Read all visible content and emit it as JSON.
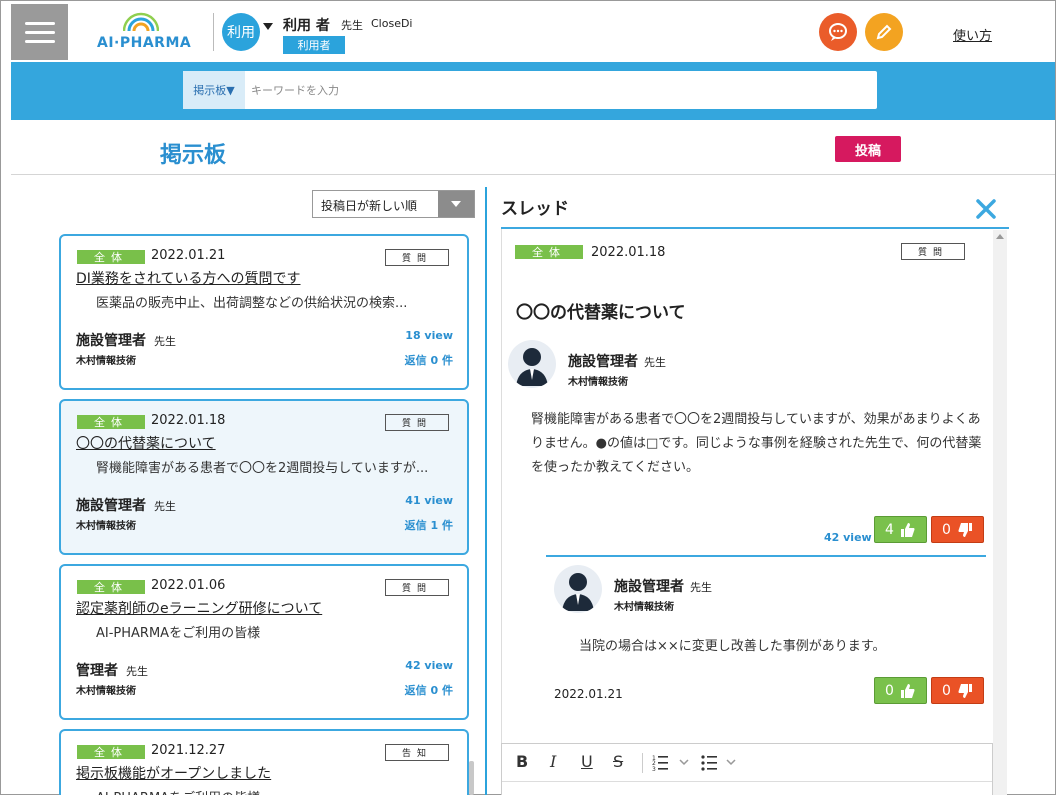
{
  "header": {
    "logo_text": "AI·PHARMA",
    "role_short": "利用",
    "user_name": "利用 者",
    "user_honorific": "先生",
    "user_org": "CloseDi",
    "user_role_badge": "利用者",
    "help_link": "使い方"
  },
  "search": {
    "category": "掲示板▼",
    "placeholder": "キーワードを入力"
  },
  "page": {
    "title": "掲示板",
    "post_button": "投稿"
  },
  "sort": {
    "selected": "投稿日が新しい順"
  },
  "posts": [
    {
      "category": "全体",
      "date": "2022.01.21",
      "type": "質問",
      "title": "DI業務をされている方への質問です",
      "excerpt": "医薬品の販売中止、出荷調整などの供給状況の検索...",
      "author": "施設管理者",
      "honorific": "先生",
      "org": "木村情報技術",
      "views": "18 view",
      "replies": "返信 0 件"
    },
    {
      "category": "全体",
      "date": "2022.01.18",
      "type": "質問",
      "title": "〇〇の代替薬について",
      "excerpt": "腎機能障害がある患者で〇〇を2週間投与していますが...",
      "author": "施設管理者",
      "honorific": "先生",
      "org": "木村情報技術",
      "views": "41 view",
      "replies": "返信 1 件"
    },
    {
      "category": "全体",
      "date": "2022.01.06",
      "type": "質問",
      "title": "認定薬剤師のeラーニング研修について",
      "excerpt": "AI-PHARMAをご利用の皆様",
      "author": "管理者",
      "honorific": "先生",
      "org": "木村情報技術",
      "views": "42 view",
      "replies": "返信 0 件"
    },
    {
      "category": "全体",
      "date": "2021.12.27",
      "type": "告知",
      "title": "掲示板機能がオープンしました",
      "excerpt": "AI-PHARMAをご利用の皆様",
      "author": "",
      "honorific": "",
      "org": "",
      "views": "",
      "replies": ""
    }
  ],
  "thread": {
    "heading": "スレッド",
    "category": "全体",
    "date": "2022.01.18",
    "type": "質問",
    "subject": "〇〇の代替薬について",
    "author": "施設管理者",
    "honorific": "先生",
    "org": "木村情報技術",
    "body": "腎機能障害がある患者で〇〇を2週間投与していますが、効果があまりよくありません。●の値は□です。同じような事例を経験された先生で、何の代替薬を使ったか教えてください。",
    "views": "42 view",
    "likes": "4",
    "dislikes": "0",
    "reply": {
      "author": "施設管理者",
      "honorific": "先生",
      "org": "木村情報技術",
      "body": "当院の場合は××に変更し改善した事例があります。",
      "date": "2022.01.21",
      "likes": "0",
      "dislikes": "0"
    }
  },
  "editor": {
    "bold": "B",
    "italic": "I",
    "underline": "U",
    "strike": "S"
  },
  "colors": {
    "brand_blue": "#34a6dd",
    "post_pink": "#d6195f",
    "category_green": "#79c04a",
    "chat_orange": "#ea5c2a",
    "edit_yellow": "#f3a321"
  }
}
